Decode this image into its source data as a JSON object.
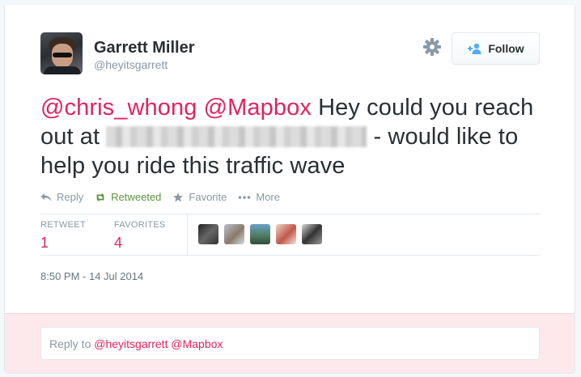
{
  "user": {
    "fullname": "Garrett Miller",
    "screenname": "@heyitsgarrett"
  },
  "follow_button": {
    "label": "Follow"
  },
  "tweet": {
    "mention1": "@chris_whong",
    "mention2": "@Mapbox",
    "text_part1": "Hey could you reach out at",
    "text_part2": "- would like to help you ride this traffic wave"
  },
  "actions": {
    "reply": "Reply",
    "retweeted": "Retweeted",
    "favorite": "Favorite",
    "more": "More"
  },
  "stats": {
    "retweets_label": "RETWEET",
    "retweets_count": "1",
    "favorites_label": "FAVORITES",
    "favorites_count": "4"
  },
  "timestamp": "8:50 PM - 14 Jul 2014",
  "reply_box": {
    "prefix": "Reply to",
    "mention1": "@heyitsgarrett",
    "mention2": "@Mapbox"
  },
  "icons": {
    "gear": "gear-icon",
    "follow": "add-user-icon",
    "reply": "reply-arrow-icon",
    "retweet": "retweet-icon",
    "favorite": "star-icon",
    "more": "ellipsis-icon"
  },
  "colors": {
    "mention": "#e0245e",
    "retweeted": "#5c913b",
    "follow_icon": "#55acee",
    "reply_bg": "#fde8ec"
  }
}
